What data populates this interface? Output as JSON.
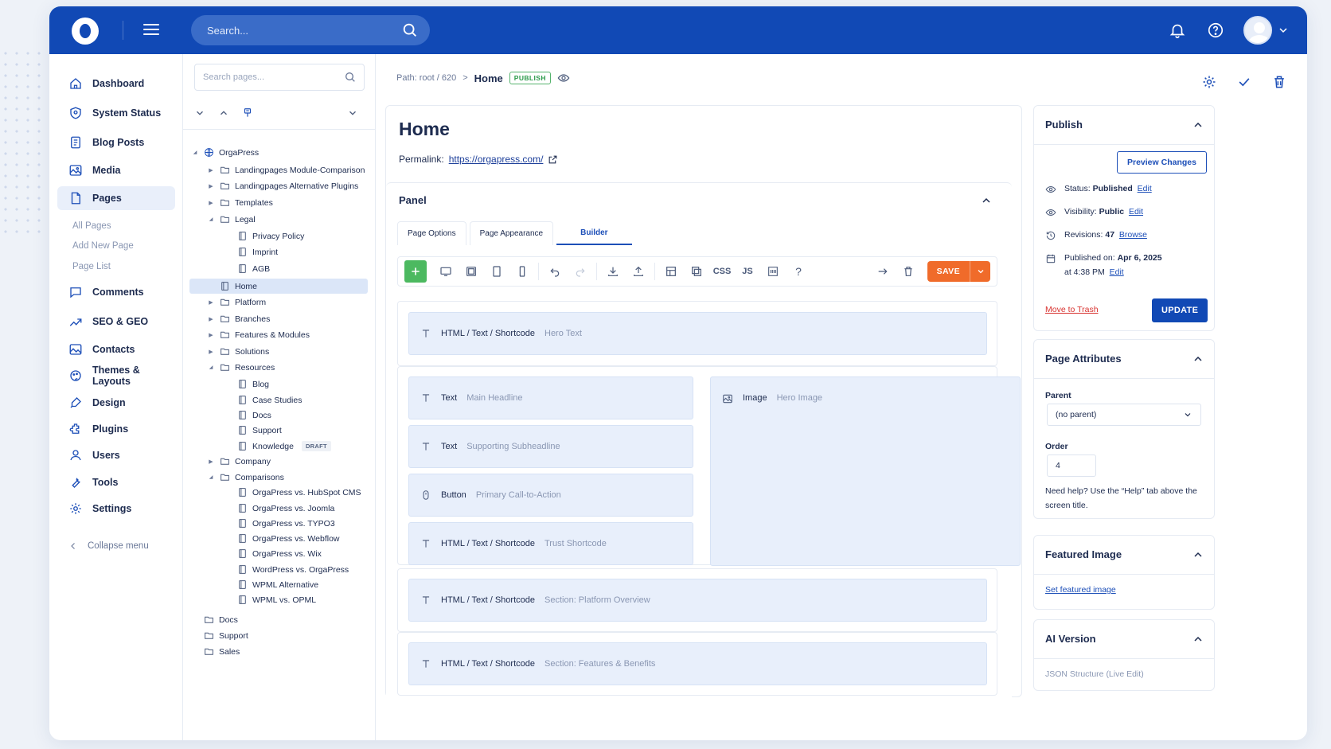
{
  "header": {
    "search_placeholder": "Search...",
    "icons": [
      "menu-icon",
      "search-icon",
      "bell-icon",
      "help-icon",
      "avatar",
      "chevron-down-icon"
    ]
  },
  "sidebar": {
    "items": [
      {
        "label": "Dashboard",
        "icon": "home-icon"
      },
      {
        "label": "System Status",
        "icon": "shield-icon"
      },
      {
        "label": "Blog Posts",
        "icon": "document-icon"
      },
      {
        "label": "Media",
        "icon": "image-icon"
      },
      {
        "label": "Pages",
        "icon": "page-icon"
      },
      {
        "label": "Comments",
        "icon": "comment-icon"
      },
      {
        "label": "SEO & GEO",
        "icon": "chart-icon"
      },
      {
        "label": "Contacts",
        "icon": "contacts-icon"
      },
      {
        "label": "Themes & Layouts",
        "icon": "palette-icon"
      },
      {
        "label": "Design",
        "icon": "brush-icon"
      },
      {
        "label": "Plugins",
        "icon": "plugin-icon"
      },
      {
        "label": "Users",
        "icon": "user-icon"
      },
      {
        "label": "Tools",
        "icon": "wrench-icon"
      },
      {
        "label": "Settings",
        "icon": "gear-icon"
      }
    ],
    "pages_sub": [
      "All Pages",
      "Add New Page",
      "Page List"
    ],
    "collapse_label": "Collapse menu"
  },
  "tree": {
    "search_placeholder": "Search pages...",
    "nodes": [
      {
        "label": "OrgaPress",
        "level": 0,
        "type": "globe",
        "caret": "down"
      },
      {
        "label": "Landingpages Module-Comparison",
        "level": 1,
        "type": "folder",
        "caret": "right"
      },
      {
        "label": "Landingpages Alternative Plugins",
        "level": 1,
        "type": "folder",
        "caret": "right"
      },
      {
        "label": "Templates",
        "level": 1,
        "type": "folder",
        "caret": "right"
      },
      {
        "label": "Legal",
        "level": 1,
        "type": "folder",
        "caret": "down"
      },
      {
        "label": "Privacy Policy",
        "level": 2,
        "type": "page"
      },
      {
        "label": "Imprint",
        "level": 2,
        "type": "page"
      },
      {
        "label": "AGB",
        "level": 2,
        "type": "page"
      },
      {
        "label": "Home",
        "level": 1,
        "type": "page",
        "selected": true
      },
      {
        "label": "Platform",
        "level": 1,
        "type": "folder",
        "caret": "right"
      },
      {
        "label": "Branches",
        "level": 1,
        "type": "folder",
        "caret": "right"
      },
      {
        "label": "Features & Modules",
        "level": 1,
        "type": "folder",
        "caret": "right"
      },
      {
        "label": "Solutions",
        "level": 1,
        "type": "folder",
        "caret": "right"
      },
      {
        "label": "Resources",
        "level": 1,
        "type": "folder",
        "caret": "down"
      },
      {
        "label": "Blog",
        "level": 2,
        "type": "page"
      },
      {
        "label": "Case Studies",
        "level": 2,
        "type": "page"
      },
      {
        "label": "Docs",
        "level": 2,
        "type": "page"
      },
      {
        "label": "Support",
        "level": 2,
        "type": "page"
      },
      {
        "label": "Knowledge",
        "level": 2,
        "type": "page",
        "badge": "DRAFT"
      },
      {
        "label": "Company",
        "level": 1,
        "type": "folder",
        "caret": "right"
      },
      {
        "label": "Comparisons",
        "level": 1,
        "type": "folder",
        "caret": "down"
      },
      {
        "label": "OrgaPress vs. HubSpot CMS",
        "level": 2,
        "type": "page"
      },
      {
        "label": "OrgaPress vs. Joomla",
        "level": 2,
        "type": "page"
      },
      {
        "label": "OrgaPress vs. TYPO3",
        "level": 2,
        "type": "page"
      },
      {
        "label": "OrgaPress vs. Webflow",
        "level": 2,
        "type": "page"
      },
      {
        "label": "OrgaPress vs. Wix",
        "level": 2,
        "type": "page"
      },
      {
        "label": "WordPress vs. OrgaPress",
        "level": 2,
        "type": "page"
      },
      {
        "label": "WPML Alternative",
        "level": 2,
        "type": "page"
      },
      {
        "label": "WPML vs. OPML",
        "level": 2,
        "type": "page"
      },
      {
        "label": "Docs",
        "level": 0,
        "type": "folder"
      },
      {
        "label": "Support",
        "level": 0,
        "type": "folder"
      },
      {
        "label": "Sales",
        "level": 0,
        "type": "folder"
      }
    ]
  },
  "main": {
    "breadcrumb_path": "Path: root / 620",
    "breadcrumb_sep": ">",
    "breadcrumb_current": "Home",
    "status_badge": "PUBLISH",
    "title": "Home",
    "permalink_label": "Permalink:",
    "permalink_url": "https://orgapress.com/",
    "panel_title": "Panel",
    "tabs": [
      "Page Options",
      "Page Appearance",
      "Builder"
    ],
    "toolbar": {
      "css_label": "CSS",
      "js_label": "JS",
      "help_label": "?",
      "save_label": "SAVE"
    },
    "blocks": {
      "hero_text": {
        "type": "HTML / Text / Shortcode",
        "desc": "Hero Text"
      },
      "main_headline": {
        "type": "Text",
        "desc": "Main Headline"
      },
      "subheadline": {
        "type": "Text",
        "desc": "Supporting Subheadline"
      },
      "cta": {
        "type": "Button",
        "desc": "Primary Call-to-Action"
      },
      "trust": {
        "type": "HTML / Text / Shortcode",
        "desc": "Trust Shortcode"
      },
      "hero_image": {
        "type": "Image",
        "desc": "Hero Image"
      },
      "platform_overview": {
        "type": "HTML / Text / Shortcode",
        "desc": "Section: Platform Overview"
      },
      "features_benefits": {
        "type": "HTML / Text / Shortcode",
        "desc": "Section: Features & Benefits"
      }
    }
  },
  "publish": {
    "title": "Publish",
    "preview_label": "Preview Changes",
    "status_label": "Status:",
    "status_value": "Published",
    "visibility_label": "Visibility:",
    "visibility_value": "Public",
    "revisions_label": "Revisions:",
    "revisions_value": "47",
    "published_label": "Published on:",
    "published_date": "Apr 6, 2025",
    "published_time": "at 4:38 PM",
    "edit_label": "Edit",
    "browse_label": "Browse",
    "trash_label": "Move to Trash",
    "update_label": "UPDATE"
  },
  "attributes": {
    "title": "Page Attributes",
    "parent_label": "Parent",
    "parent_value": "(no parent)",
    "order_label": "Order",
    "order_value": "4",
    "help_text": "Need help? Use the “Help” tab above the screen title."
  },
  "featured": {
    "title": "Featured Image",
    "set_label": "Set featured image"
  },
  "ai": {
    "title": "AI Version",
    "subtitle": "JSON Structure (Live Edit)"
  },
  "colors": {
    "brand": "#1149b5",
    "save": "#f06b2a",
    "add": "#4cb960",
    "publish_badge": "#2b9a4a",
    "trash": "#d8322f"
  }
}
